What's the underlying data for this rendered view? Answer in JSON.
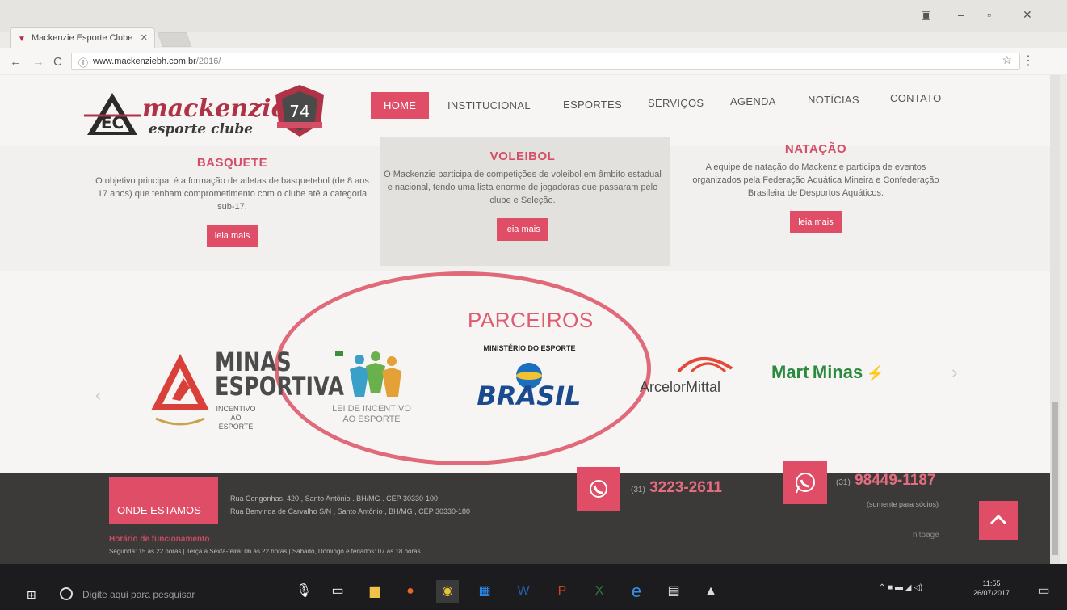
{
  "browser": {
    "tab_title": "Mackenzie Esporte Clube",
    "url_host": "www.mackenziebh.com.br",
    "url_path": "/2016/",
    "window_controls": [
      "–",
      "▫",
      "✕"
    ]
  },
  "site": {
    "logo_line1": "mackenzie",
    "logo_line2": "esporte clube",
    "badge_number": "74",
    "nav": [
      "HOME",
      "INSTITUCIONAL",
      "ESPORTES",
      "SERVIÇOS",
      "AGENDA",
      "NOTÍCIAS",
      "CONTATO"
    ],
    "sports": [
      {
        "title": "BASQUETE",
        "desc": "O objetivo principal é a formação de atletas de basquetebol (de 8 aos 17 anos) que tenham comprometimento com o clube até a categoria sub-17.",
        "button": "leia mais"
      },
      {
        "title": "VOLEIBOL",
        "desc": "O Mackenzie participa de competições de voleibol em âmbito estadual e nacional, tendo uma lista enorme de jogadoras que passaram pelo clube e Seleção.",
        "button": "leia mais"
      },
      {
        "title": "NATAÇÃO",
        "desc": "A equipe de natação do Mackenzie participa de eventos organizados pela Federação Aquática Mineira e Confederação Brasileira de Desportos Aquáticos.",
        "button": "leia mais"
      }
    ],
    "partners_title": "PARCEIROS",
    "partners": {
      "minas_title": "MINAS ESPORTIVA",
      "minas_sub": "INCENTIVO AO ESPORTE",
      "lei": "LEI DE INCENTIVO AO ESPORTE",
      "ministerio": "MINISTÉRIO DO ESPORTE",
      "brasil": "BRASIL",
      "arcelor": "ArcelorMittal",
      "mart_a": "Mart",
      "mart_b": "Minas"
    },
    "footer": {
      "onde": "ONDE ESTAMOS",
      "addr1": "Rua Congonhas, 420 , Santo Antônio . BH/MG . CEP 30330-100",
      "addr2": "Rua Benvinda de Carvalho S/N , Santo Antônio , BH/MG , CEP 30330-180",
      "phone1_ddd": "(31)",
      "phone1": "3223-2611",
      "phone2_ddd": "(31)",
      "phone2": "98449-1187",
      "phone2_note": "(somente para sócios)",
      "horario_title": "Horário de funcionamento",
      "horario": "Segunda: 15 às 22 horas  |  Terça a Sexta-feira: 06 às 22 horas  |  Sábado, Domingo e feriados: 07 às 18 horas",
      "brand": "nitpage"
    }
  },
  "taskbar": {
    "search_placeholder": "Digite aqui para pesquisar",
    "time": "11:55",
    "date": "26/07/2017"
  },
  "colors": {
    "accent": "#e04d67",
    "footer": "#3c3a38"
  }
}
